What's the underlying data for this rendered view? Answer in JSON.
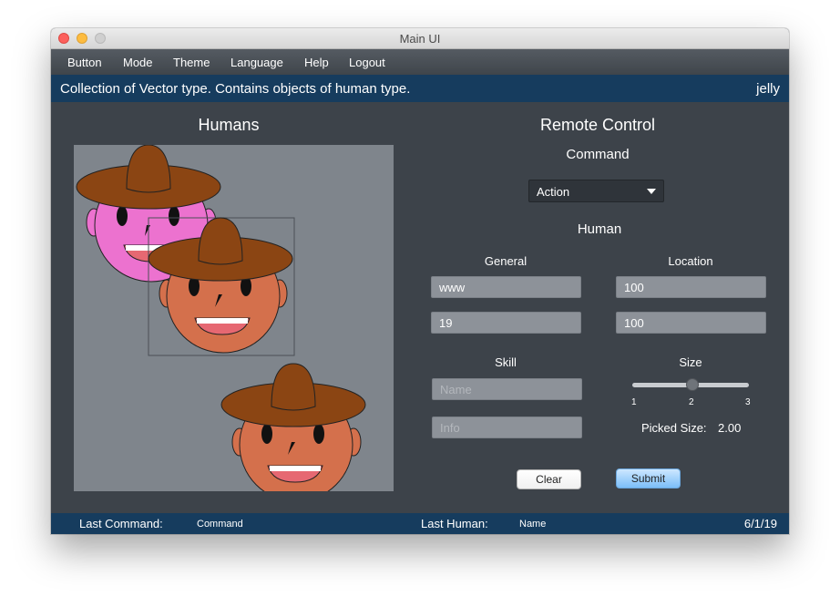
{
  "window": {
    "title": "Main UI"
  },
  "menu": {
    "items": [
      "Button",
      "Mode",
      "Theme",
      "Language",
      "Help",
      "Logout"
    ]
  },
  "info": {
    "text": "Collection of Vector type. Contains objects of human type.",
    "user": "jelly"
  },
  "humans_panel": {
    "title": "Humans"
  },
  "remote": {
    "title": "Remote Control",
    "command_label": "Command",
    "command_value": "Action",
    "human_label": "Human",
    "general_label": "General",
    "location_label": "Location",
    "general_name": "www",
    "general_age": "19",
    "location_x": "100",
    "location_y": "100",
    "skill_label": "Skill",
    "skill_name_placeholder": "Name",
    "skill_info_placeholder": "Info",
    "size_label": "Size",
    "size_ticks": [
      "1",
      "2",
      "3"
    ],
    "size_value": 2,
    "picked_size_label": "Picked Size:",
    "picked_size_value": "2.00",
    "clear_label": "Clear",
    "submit_label": "Submit"
  },
  "status": {
    "last_command_label": "Last Command:",
    "last_command_value": "Command",
    "last_human_label": "Last Human:",
    "last_human_value": "Name",
    "date": "6/1/19"
  },
  "colors": {
    "background": "#3d434a",
    "infobar": "#163c5e",
    "canvas": "#7f858c",
    "hat": "#8b4513",
    "face_pink": "#ec72cf",
    "face_tan": "#d4704c",
    "mouth": "#e66872"
  }
}
